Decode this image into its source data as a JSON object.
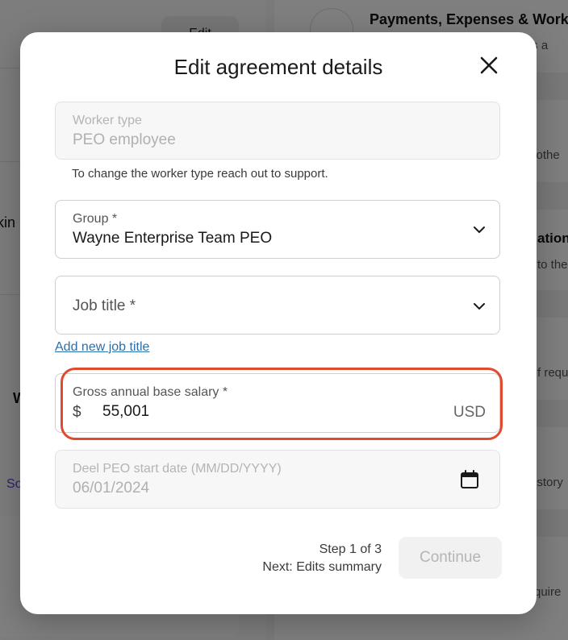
{
  "background": {
    "edit_label": "Edit",
    "left_fragments": [
      "kin",
      "W",
      "So"
    ],
    "right_heading": "Payments, Expenses & Work",
    "right_fragments": [
      "ices a",
      "d othe",
      "ation",
      "to the",
      "f requ",
      "istory",
      "quire"
    ]
  },
  "modal": {
    "title": "Edit agreement details",
    "worker_type": {
      "label": "Worker type",
      "value": "PEO employee",
      "helper": "To change the worker type reach out to support."
    },
    "group": {
      "label": "Group *",
      "value": "Wayne Enterprise Team PEO"
    },
    "job_title": {
      "label": "Job title *"
    },
    "add_job_title_link": "Add new job title",
    "salary": {
      "label": "Gross annual base salary *",
      "currency_symbol": "$",
      "value": "55,001",
      "currency_code": "USD"
    },
    "start_date": {
      "label": "Deel PEO start date (MM/DD/YYYY)",
      "value": "06/01/2024"
    },
    "footer": {
      "step": "Step 1 of 3",
      "next": "Next: Edits summary",
      "continue_label": "Continue"
    }
  },
  "colors": {
    "highlight": "#e04a2f",
    "link": "#2d6fa8"
  }
}
